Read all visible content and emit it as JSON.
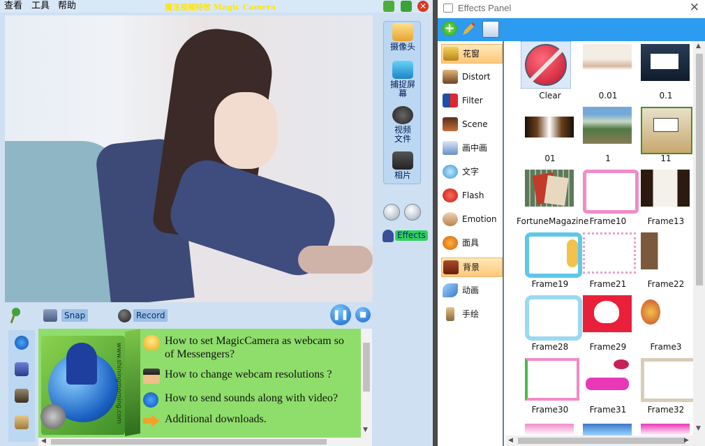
{
  "app": {
    "title": "魔法视频特效 Magic Camera",
    "menu": [
      "查看",
      "工具",
      "帮助"
    ]
  },
  "tools": [
    {
      "label": "摄像头",
      "icon": "webcam-icon"
    },
    {
      "label": "捕捉屏幕",
      "icon": "monitor-icon"
    },
    {
      "label": "视频文件",
      "icon": "film-reel-icon"
    },
    {
      "label": "相片",
      "icon": "photos-icon"
    }
  ],
  "effects_button": "Effects",
  "bottom": {
    "snap_label": "Snap",
    "record_label": "Record"
  },
  "info": {
    "links": [
      {
        "text": "How to set MagicCamera as webcam so",
        "text2": "of Messengers?",
        "icon": "lightbulb-icon"
      },
      {
        "text": "How to change webcam resolutions ?",
        "icon": "graduate-icon"
      },
      {
        "text": "How to send sounds along with video?",
        "icon": "info-icon"
      },
      {
        "text": "Additional downloads.",
        "icon": "arrow-right-icon"
      }
    ],
    "box_url": "www.shiningmorning.com"
  },
  "effects_panel": {
    "title": "Effects Panel",
    "categories": [
      {
        "label": "花窗",
        "selected": true,
        "icon": "frame-icon"
      },
      {
        "label": "Distort",
        "selected": false,
        "icon": "distort-icon"
      },
      {
        "label": "Filter",
        "selected": false,
        "icon": "filter-icon"
      },
      {
        "label": "Scene",
        "selected": false,
        "icon": "scene-icon"
      },
      {
        "label": "画中画",
        "selected": false,
        "icon": "picture-in-picture-icon"
      },
      {
        "label": "文字",
        "selected": false,
        "icon": "text-icon"
      },
      {
        "label": "Flash",
        "selected": false,
        "icon": "flash-icon"
      },
      {
        "label": "Emotion",
        "selected": false,
        "icon": "emotion-icon"
      },
      {
        "label": "面具",
        "selected": false,
        "icon": "pumpkin-mask-icon"
      },
      {
        "label": "背景",
        "selected": true,
        "icon": "background-icon"
      },
      {
        "label": "动画",
        "selected": false,
        "icon": "butterfly-icon"
      },
      {
        "label": "手绘",
        "selected": false,
        "icon": "brush-icon"
      }
    ],
    "thumbnails": [
      "Clear",
      "0.01",
      "0.1",
      "01",
      "1",
      "11",
      "FortuneMagazine",
      "Frame10",
      "Frame13",
      "Frame19",
      "Frame21",
      "Frame22",
      "Frame28",
      "Frame29",
      "Frame3",
      "Frame30",
      "Frame31",
      "Frame32"
    ]
  },
  "colors": {
    "menubar": "#d9e8f7",
    "panel": "#cfe0f3",
    "info_bg": "#8fde6b",
    "ep_toolbar": "#2d9bf0",
    "selected_cat": "#ffc87a"
  }
}
